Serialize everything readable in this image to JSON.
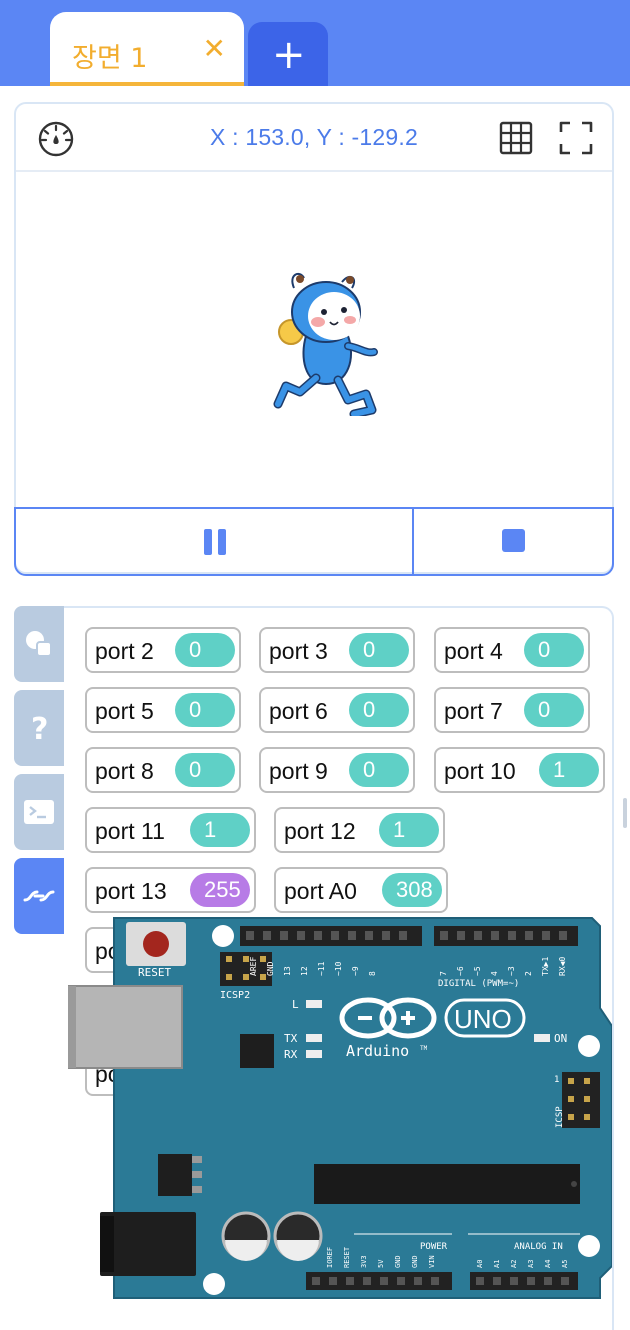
{
  "tabs": {
    "scene_label": "장면 1",
    "close_glyph": "✕",
    "add_glyph": "+"
  },
  "stage": {
    "coords": "X : 153.0, Y : -129.2"
  },
  "side_tabs": [
    "objects",
    "help",
    "console",
    "hardware"
  ],
  "ports": [
    {
      "label": "port 2",
      "value": "0"
    },
    {
      "label": "port 3",
      "value": "0"
    },
    {
      "label": "port 4",
      "value": "0"
    },
    {
      "label": "port 5",
      "value": "0"
    },
    {
      "label": "port 6",
      "value": "0"
    },
    {
      "label": "port 7",
      "value": "0"
    },
    {
      "label": "port 8",
      "value": "0"
    },
    {
      "label": "port 9",
      "value": "0"
    },
    {
      "label": "port 10",
      "value": "1"
    },
    {
      "label": "port 11",
      "value": "1"
    },
    {
      "label": "port 12",
      "value": "1"
    },
    {
      "label": "port 13",
      "value": "255"
    },
    {
      "label": "port A0",
      "value": "308"
    }
  ],
  "hidden_port_fragments": [
    "po",
    "po"
  ],
  "board": {
    "reset": "RESET",
    "icsp2": "ICSP2",
    "icsp": "ICSP",
    "digital": "DIGITAL (PWM=~)",
    "uno": "UNO",
    "brand": "Arduino",
    "tm": "TM",
    "on": "ON",
    "l": "L",
    "tx": "TX",
    "rx": "RX",
    "power": "POWER",
    "analog": "ANALOG IN",
    "one": "1",
    "top_pins": [
      "AREF",
      "GND",
      "13",
      "12",
      "~11",
      "~10",
      "~9",
      "8",
      "7",
      "~6",
      "~5",
      "4",
      "~3",
      "2",
      "TX▶1",
      "RX◀0"
    ],
    "power_pins": [
      "IOREF",
      "RESET",
      "3V3",
      "5V",
      "GND",
      "GND",
      "VIN"
    ],
    "analog_pins": [
      "A0",
      "A1",
      "A2",
      "A3",
      "A4",
      "A5"
    ]
  },
  "colors": {
    "accent": "#5b86f4",
    "tab_text": "#f2ad2e",
    "value_pill": "#5fd0c6",
    "value_pill_high": "#b77be6",
    "board": "#2b7a96"
  }
}
